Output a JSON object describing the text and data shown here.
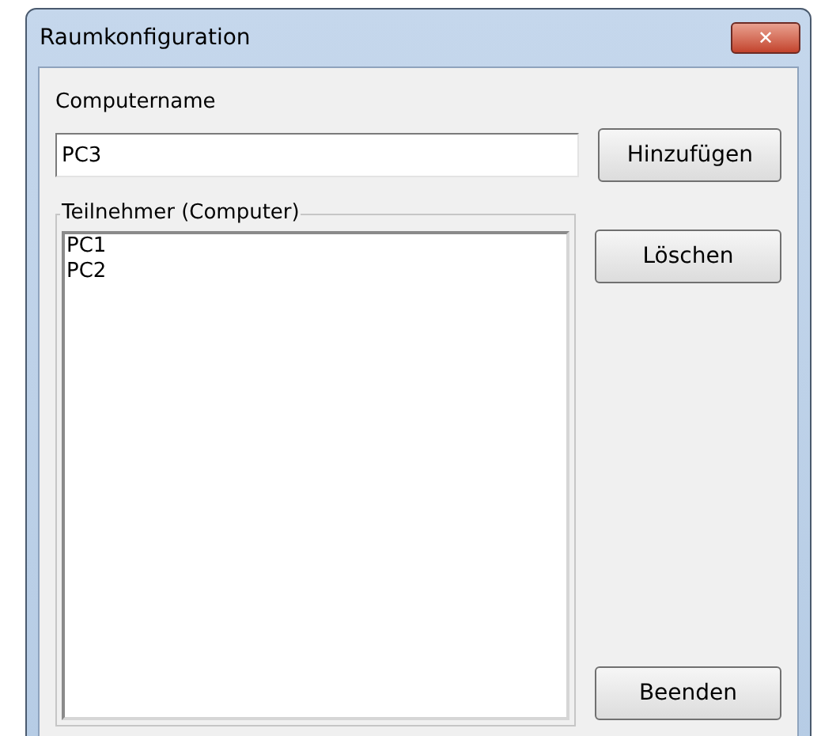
{
  "window": {
    "title": "Raumkonfiguration",
    "close_glyph": "✕"
  },
  "computer_name": {
    "label": "Computername",
    "value": "PC3"
  },
  "add_button": "Hinzufügen",
  "participants": {
    "legend": "Teilnehmer (Computer)",
    "items": [
      "PC1",
      "PC2"
    ]
  },
  "delete_button": "Löschen",
  "exit_button": "Beenden"
}
